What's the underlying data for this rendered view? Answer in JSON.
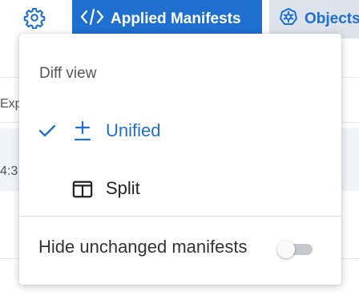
{
  "header": {
    "settings_icon": "gear-icon",
    "tabs": [
      {
        "label": "Applied Manifests",
        "icon": "code-icon",
        "active": true
      },
      {
        "label": "Objects",
        "icon": "kubernetes-icon",
        "active": false
      }
    ]
  },
  "background": {
    "row_label": "Explo",
    "timestamp": "4:3"
  },
  "menu": {
    "section_title": "Diff view",
    "items": [
      {
        "label": "Unified",
        "icon": "plus-minus-icon",
        "selected": true
      },
      {
        "label": "Split",
        "icon": "split-columns-icon",
        "selected": false
      }
    ],
    "toggle": {
      "label": "Hide unchanged manifests",
      "on": false
    }
  },
  "colors": {
    "accent": "#1e6fd0",
    "tab_inactive_bg": "#dde3ea",
    "text": "#222222"
  }
}
